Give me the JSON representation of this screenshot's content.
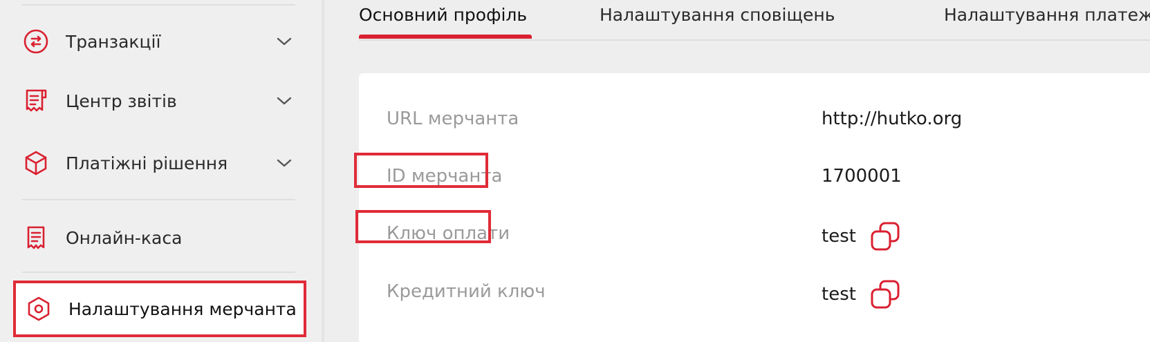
{
  "sidebar": {
    "items": [
      {
        "label": "Транзакції",
        "icon": "transactions-icon",
        "expandable": true
      },
      {
        "label": "Центр звітів",
        "icon": "reports-icon",
        "expandable": true
      },
      {
        "label": "Платіжні рішення",
        "icon": "box-icon",
        "expandable": true
      },
      {
        "label": "Онлайн-каса",
        "icon": "receipt-icon",
        "expandable": false
      },
      {
        "label": "Налаштування мерчанта",
        "icon": "settings-icon",
        "expandable": false,
        "active": true
      }
    ]
  },
  "tabs": [
    {
      "label": "Основний профіль",
      "active": true
    },
    {
      "label": "Налаштування сповіщень"
    },
    {
      "label": "Налаштування платежів"
    }
  ],
  "profile": {
    "rows": [
      {
        "label": "URL мерчанта",
        "value": "http://hutko.org"
      },
      {
        "label": "ID мерчанта",
        "value": "1700001"
      },
      {
        "label": "Ключ оплати",
        "value": "test",
        "copyable": true
      },
      {
        "label": "Кредитний ключ",
        "value": "test",
        "copyable": true
      }
    ]
  },
  "colors": {
    "accent": "#d92030",
    "highlight": "#e02b38",
    "sidebar_bg": "#f0efef",
    "label_gray": "#9a9a9a"
  }
}
